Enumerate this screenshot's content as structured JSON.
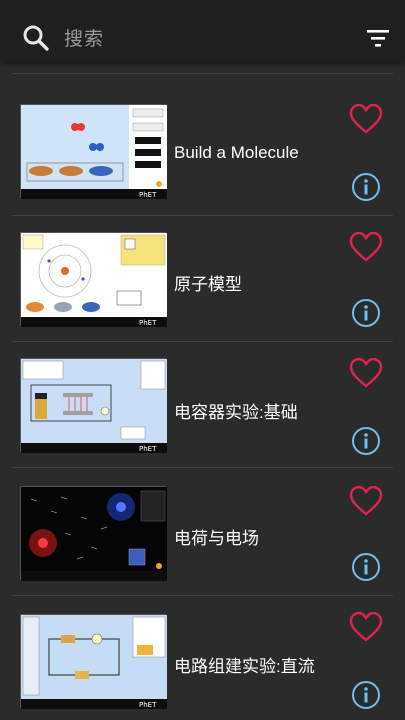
{
  "search": {
    "placeholder": "搜索",
    "icon": "search-icon"
  },
  "filter": {
    "icon": "filter-icon"
  },
  "colors": {
    "heart": "#e0254a",
    "info": "#6ec0f0",
    "background": "#2b2b2b",
    "topbar": "#1f1f1f"
  },
  "simulations": [
    {
      "title": ""
    },
    {
      "title": "Build a Molecule"
    },
    {
      "title": "原子模型"
    },
    {
      "title": "电容器实验:基础"
    },
    {
      "title": "电荷与电场"
    },
    {
      "title": "电路组建实验:直流"
    }
  ]
}
